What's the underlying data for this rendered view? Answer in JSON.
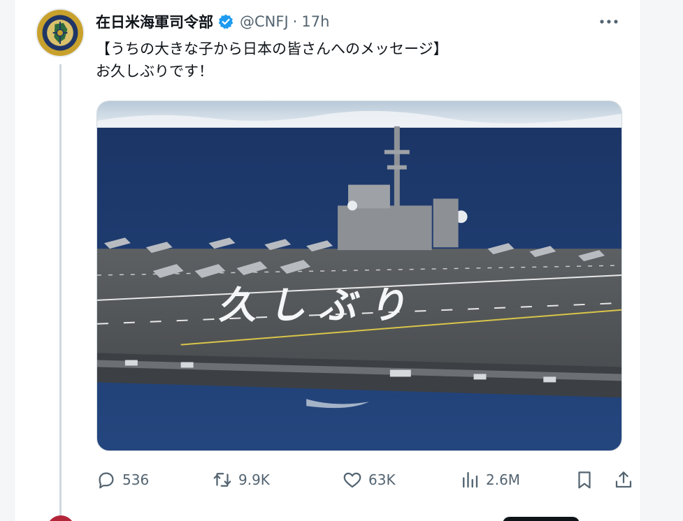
{
  "tweet": {
    "display_name": "在日米海軍司令部",
    "handle": "@CNFJ",
    "separator": "·",
    "time": "17h",
    "text_line1": "【うちの大きな子から日本の皆さんへのメッセージ】",
    "text_line2": "お久しぶりです！",
    "media_caption": "久しぶり"
  },
  "actions": {
    "replies": "536",
    "reposts": "9.9K",
    "likes": "63K",
    "views": "2.6M"
  },
  "icons": {
    "verified": "verified-badge-icon",
    "more": "more-icon",
    "reply": "reply-icon",
    "repost": "repost-icon",
    "like": "like-icon",
    "views": "views-icon",
    "bookmark": "bookmark-icon",
    "share": "share-icon"
  },
  "colors": {
    "accent": "#1d9bf0",
    "text": "#0f1419",
    "muted": "#536471",
    "avatar_gold": "#c8a12c",
    "ocean": "#1e3a6b"
  }
}
